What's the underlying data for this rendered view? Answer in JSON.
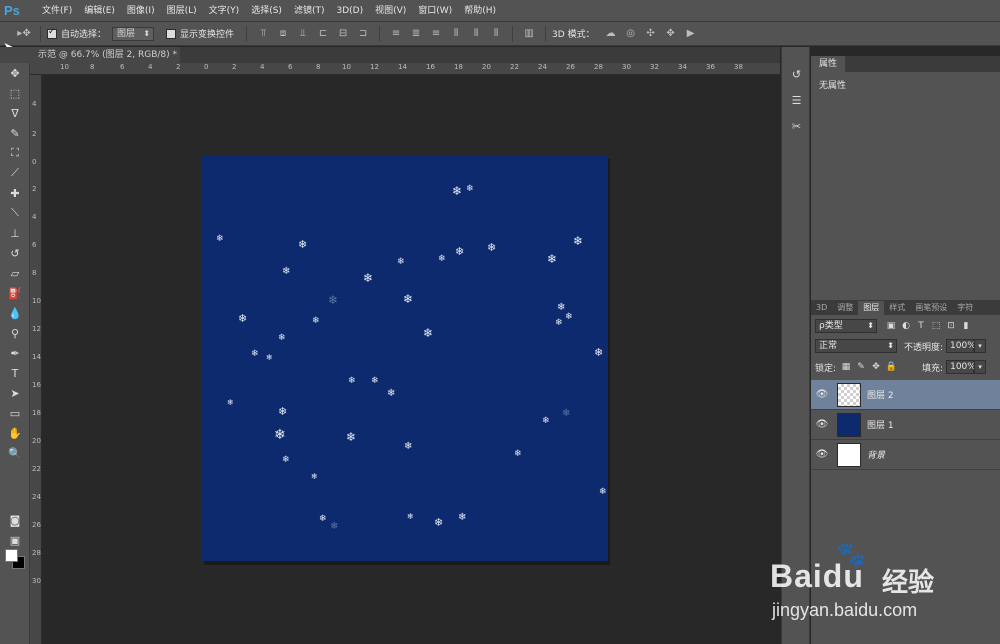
{
  "app": {
    "logo": "Ps"
  },
  "menu": [
    "文件(F)",
    "编辑(E)",
    "图像(I)",
    "图层(L)",
    "文字(Y)",
    "选择(S)",
    "滤镜(T)",
    "3D(D)",
    "视图(V)",
    "窗口(W)",
    "帮助(H)"
  ],
  "options": {
    "auto_select_label": "自动选择：",
    "auto_select_value": "图层",
    "show_transform_label": "显示变换控件",
    "mode_3d_label": "3D 模式："
  },
  "document": {
    "tab_title": "示范 @ 66.7% (图层 2, RGB/8) *"
  },
  "rulers": {
    "top": [
      "10",
      "8",
      "6",
      "4",
      "2",
      "0",
      "2",
      "4",
      "6",
      "8",
      "10",
      "12",
      "14",
      "16",
      "18",
      "20",
      "22",
      "24",
      "26",
      "28",
      "30",
      "32",
      "34",
      "36",
      "38"
    ],
    "left": [
      "4",
      "2",
      "0",
      "2",
      "4",
      "6",
      "8",
      "10",
      "12",
      "14",
      "16",
      "18",
      "20",
      "22",
      "24",
      "26",
      "28",
      "30"
    ]
  },
  "properties": {
    "tab": "属性",
    "body": "无属性"
  },
  "layers_panel": {
    "tabs": [
      "3D",
      "调整",
      "图层",
      "样式",
      "画笔预设",
      "字符"
    ],
    "active_tab": "图层",
    "filter_label": "ρ类型",
    "blend_mode": "正常",
    "opacity_label": "不透明度:",
    "opacity_value": "100%",
    "lock_label": "锁定:",
    "fill_label": "填充:",
    "fill_value": "100%",
    "layers": [
      {
        "name": "图层 2",
        "thumb": "checker",
        "selected": true,
        "italic": false
      },
      {
        "name": "图层 1",
        "thumb": "blue",
        "selected": false,
        "italic": false
      },
      {
        "name": "背景",
        "thumb": "white",
        "selected": false,
        "italic": true
      }
    ]
  },
  "watermark": {
    "logo": "Bai",
    "logo2": "du",
    "cn": "经验",
    "url": "jingyan.baidu.com"
  },
  "colors": {
    "canvas": "#0d2a6e",
    "foreground": "#ffffff",
    "background": "#000000",
    "selected_layer": "#6f819b"
  }
}
